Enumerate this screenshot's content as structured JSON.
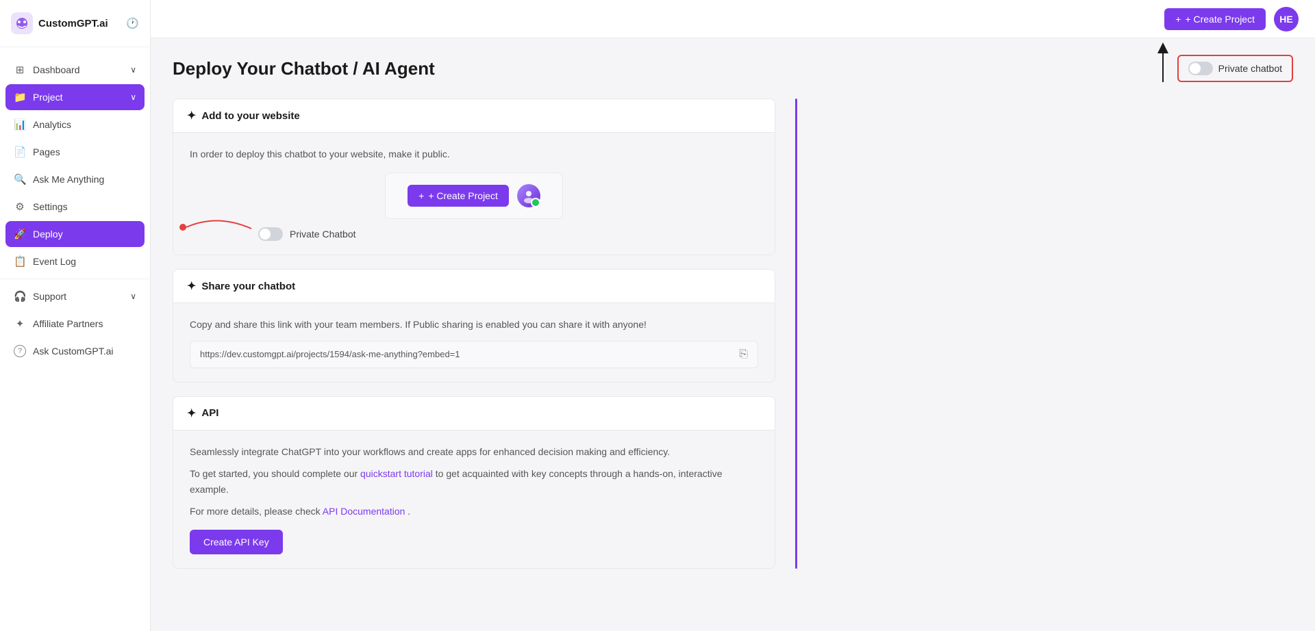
{
  "app": {
    "name": "CustomGPT.ai",
    "logo_text": "CustomGPT.ai"
  },
  "header": {
    "create_project_label": "+ Create Project",
    "avatar_initials": "HE"
  },
  "sidebar": {
    "items": [
      {
        "id": "dashboard",
        "label": "Dashboard",
        "icon": "⊞",
        "has_chevron": true,
        "active": false
      },
      {
        "id": "project",
        "label": "Project",
        "icon": "📁",
        "has_chevron": true,
        "active": true
      },
      {
        "id": "analytics",
        "label": "Analytics",
        "icon": "📊",
        "has_chevron": false,
        "active": false
      },
      {
        "id": "pages",
        "label": "Pages",
        "icon": "📄",
        "has_chevron": false,
        "active": false
      },
      {
        "id": "ask-me-anything",
        "label": "Ask Me Anything",
        "icon": "🔍",
        "has_chevron": false,
        "active": false
      },
      {
        "id": "settings",
        "label": "Settings",
        "icon": "⚙",
        "has_chevron": false,
        "active": false
      },
      {
        "id": "deploy",
        "label": "Deploy",
        "icon": "🚀",
        "has_chevron": false,
        "active": true
      },
      {
        "id": "event-log",
        "label": "Event Log",
        "icon": "📋",
        "has_chevron": false,
        "active": false
      },
      {
        "id": "support",
        "label": "Support",
        "icon": "🎧",
        "has_chevron": true,
        "active": false
      },
      {
        "id": "affiliate",
        "label": "Affiliate Partners",
        "icon": "✦",
        "has_chevron": false,
        "active": false
      },
      {
        "id": "ask-customgpt",
        "label": "Ask CustomGPT.ai",
        "icon": "?",
        "has_chevron": false,
        "active": false
      }
    ]
  },
  "page": {
    "title": "Deploy Your Chatbot / AI Agent",
    "private_chatbot_label": "Private chatbot"
  },
  "sections": {
    "add_to_website": {
      "title": "Add to your website",
      "description": "In order to deploy this chatbot to your website, make it public.",
      "create_project_btn": "+ Create Project",
      "private_chatbot_label": "Private Chatbot"
    },
    "share_chatbot": {
      "title": "Share your chatbot",
      "description": "Copy and share this link with your team members. If Public sharing is enabled you can share it with anyone!",
      "share_url": "https://dev.customgpt.ai/projects/1594/ask-me-anything?embed=1"
    },
    "api": {
      "title": "API",
      "description_1": "Seamlessly integrate ChatGPT into your workflows and create apps for enhanced decision making and efficiency.",
      "description_2": "To get started, you should complete our",
      "quickstart_link": "quickstart tutorial",
      "description_3": " to get acquainted with key concepts through a hands-on, interactive example.",
      "description_4": "For more details, please check ",
      "api_docs_link": "API Documentation",
      "period": ".",
      "create_api_btn": "Create API Key"
    }
  }
}
